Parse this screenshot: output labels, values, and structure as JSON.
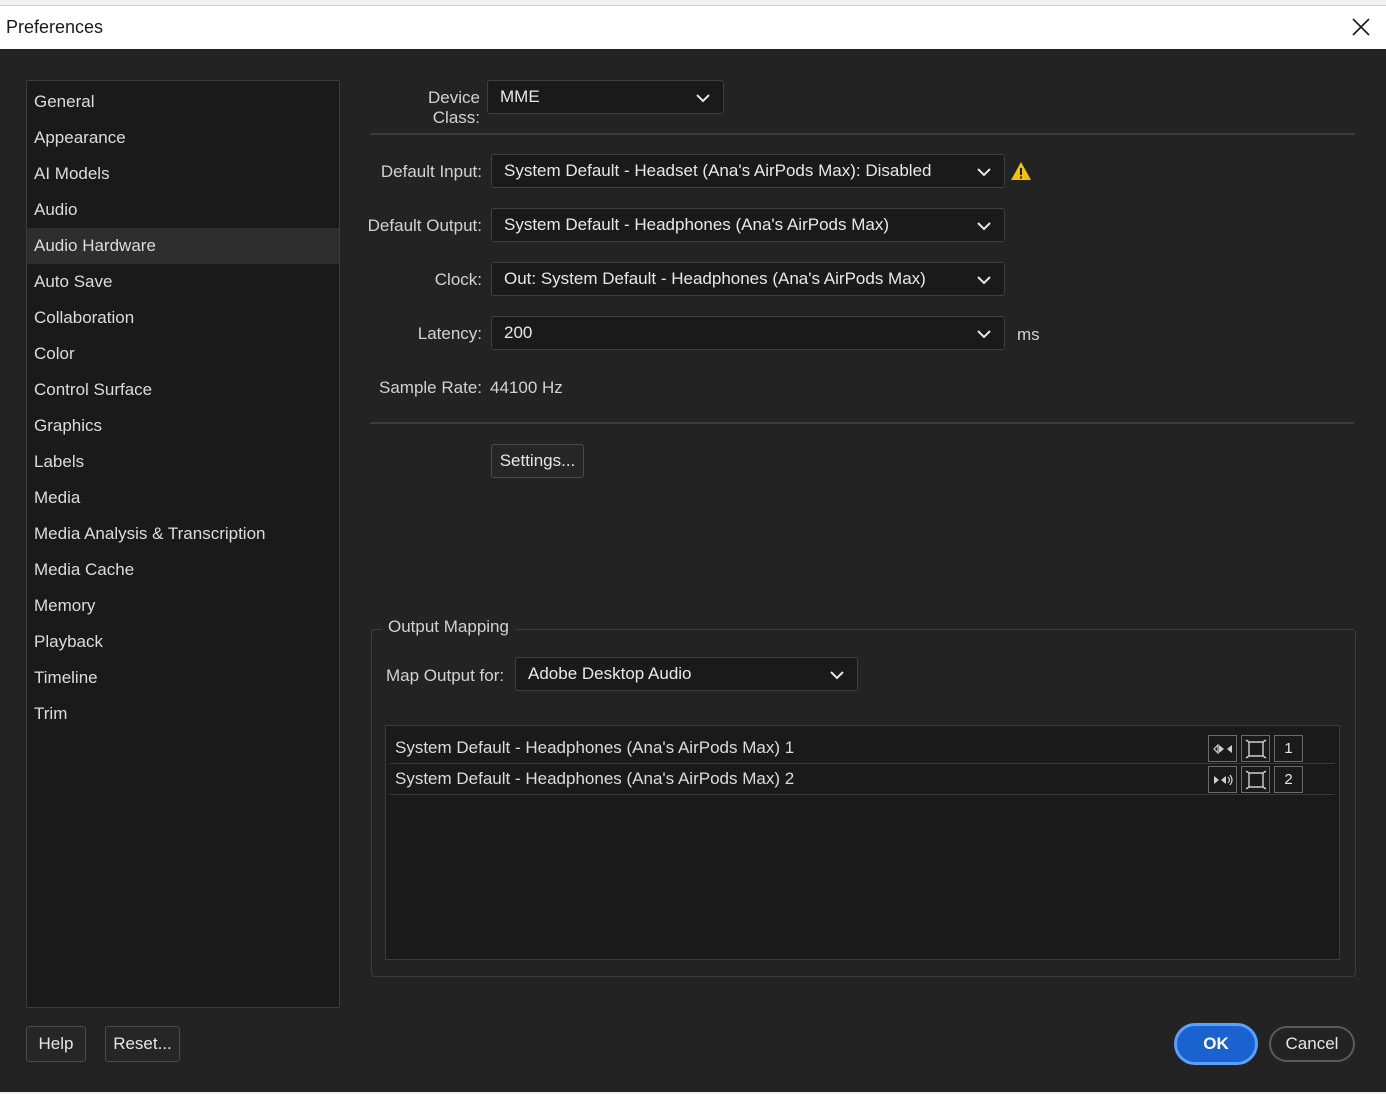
{
  "window": {
    "title": "Preferences"
  },
  "sidebar": {
    "items": [
      {
        "label": "General"
      },
      {
        "label": "Appearance"
      },
      {
        "label": "AI Models"
      },
      {
        "label": "Audio"
      },
      {
        "label": "Audio Hardware"
      },
      {
        "label": "Auto Save"
      },
      {
        "label": "Collaboration"
      },
      {
        "label": "Color"
      },
      {
        "label": "Control Surface"
      },
      {
        "label": "Graphics"
      },
      {
        "label": "Labels"
      },
      {
        "label": "Media"
      },
      {
        "label": "Media Analysis & Transcription"
      },
      {
        "label": "Media Cache"
      },
      {
        "label": "Memory"
      },
      {
        "label": "Playback"
      },
      {
        "label": "Timeline"
      },
      {
        "label": "Trim"
      }
    ],
    "selected": "Audio Hardware"
  },
  "device_class": {
    "label": "Device Class:",
    "value": "MME"
  },
  "default_input": {
    "label": "Default Input:",
    "value": "System Default - Headset (Ana's AirPods Max): Disabled",
    "warning_icon": "warning-icon",
    "warning_color": "#f2c200"
  },
  "default_output": {
    "label": "Default Output:",
    "value": "System Default - Headphones (Ana's AirPods Max)"
  },
  "clock": {
    "label": "Clock:",
    "value": "Out: System Default - Headphones (Ana's AirPods Max)"
  },
  "latency": {
    "label": "Latency:",
    "value": "200",
    "unit": "ms"
  },
  "sample_rate": {
    "label": "Sample Rate:",
    "value": "44100 Hz"
  },
  "settings_button": "Settings...",
  "output_mapping": {
    "title": "Output Mapping",
    "map_for_label": "Map Output for:",
    "map_for_value": "Adobe Desktop Audio",
    "rows": [
      {
        "label": "System Default - Headphones (Ana's AirPods Max) 1",
        "channel": "1"
      },
      {
        "label": "System Default - Headphones (Ana's AirPods Max) 2",
        "channel": "2"
      }
    ]
  },
  "footer": {
    "help": "Help",
    "reset": "Reset...",
    "ok": "OK",
    "cancel": "Cancel"
  },
  "colors": {
    "accent": "#1a62cf",
    "focus_ring": "#5aa0ff",
    "background": "#232323",
    "panel": "#1a1a1a"
  }
}
